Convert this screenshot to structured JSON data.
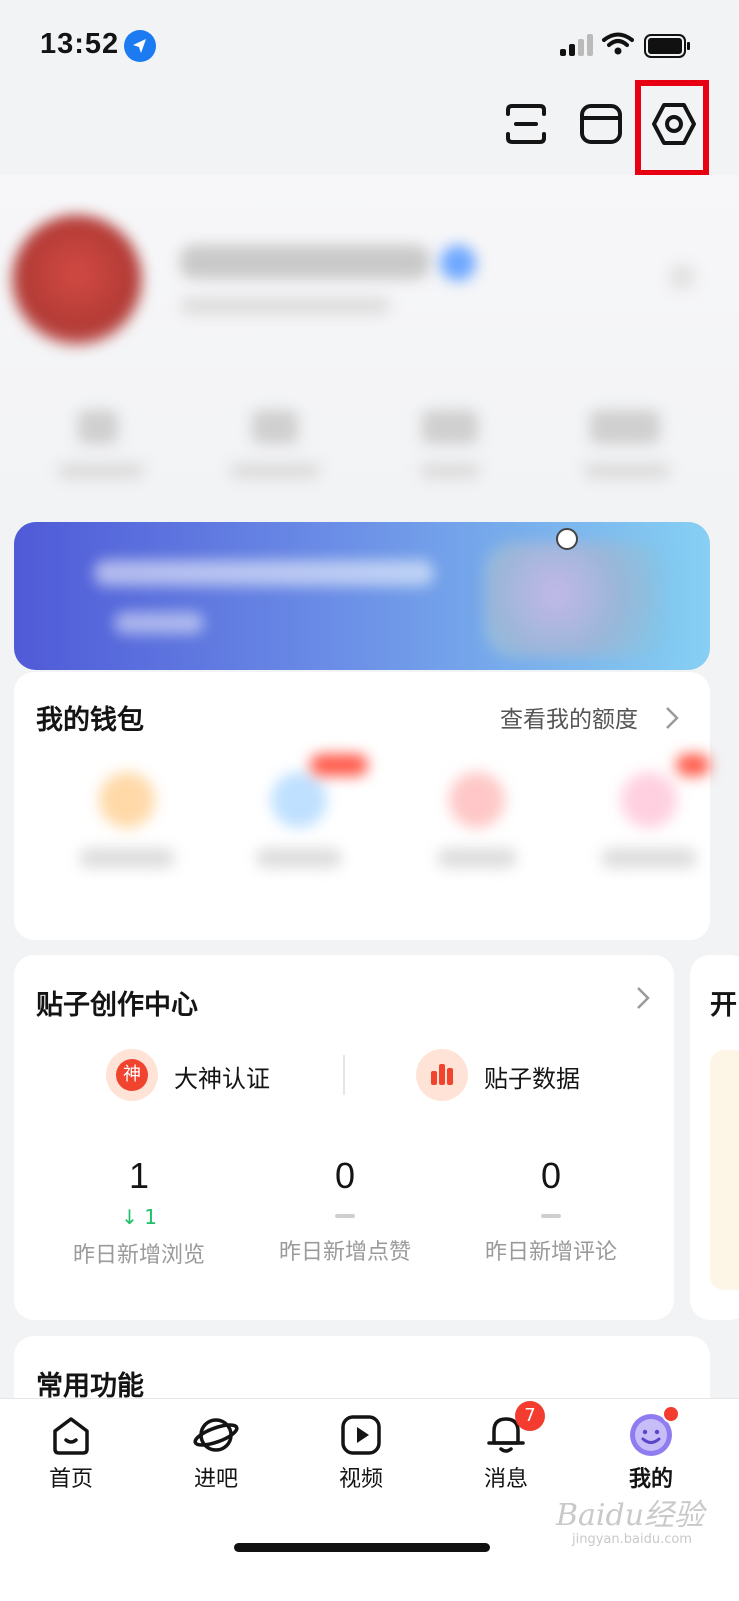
{
  "status": {
    "time": "13:52"
  },
  "header": {
    "icons": [
      "scan-icon",
      "box-icon",
      "settings-icon"
    ]
  },
  "wallet": {
    "title": "我的钱包",
    "link": "查看我的额度"
  },
  "creation": {
    "title": "贴子创作中心",
    "actions": [
      {
        "label": "大神认证",
        "badge": "神"
      },
      {
        "label": "贴子数据"
      }
    ],
    "stats": [
      {
        "value": "1",
        "delta": "1",
        "label": "昨日新增浏览"
      },
      {
        "value": "0",
        "label": "昨日新增点赞"
      },
      {
        "value": "0",
        "label": "昨日新增评论"
      }
    ]
  },
  "peek_card": {
    "title_char": "开"
  },
  "common": {
    "title": "常用功能"
  },
  "tabs": [
    {
      "label": "首页",
      "icon": "home-icon"
    },
    {
      "label": "进吧",
      "icon": "planet-icon"
    },
    {
      "label": "视频",
      "icon": "video-icon"
    },
    {
      "label": "消息",
      "icon": "bell-icon",
      "badge": "7"
    },
    {
      "label": "我的",
      "icon": "profile-face-icon",
      "active": true
    }
  ],
  "watermark": {
    "main": "Baidu经验",
    "sub": "jingyan.baidu.com"
  },
  "colors": {
    "accent_red": "#e60012",
    "badge_red": "#f33b2f",
    "green": "#1fbf6a",
    "banner_start": "#4f5ad7",
    "banner_end": "#86d0f3"
  }
}
